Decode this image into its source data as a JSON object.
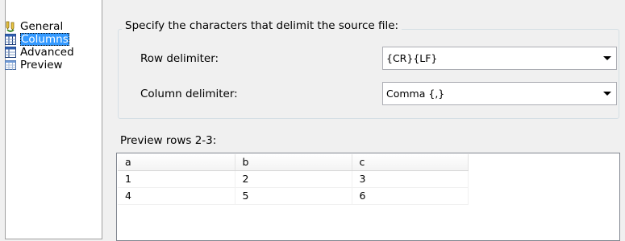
{
  "nav": {
    "items": [
      {
        "label": "General",
        "icon": "general-icon",
        "selected": false
      },
      {
        "label": "Columns",
        "icon": "columns-icon",
        "selected": true
      },
      {
        "label": "Advanced",
        "icon": "advanced-icon",
        "selected": false
      },
      {
        "label": "Preview",
        "icon": "preview-icon",
        "selected": false
      }
    ]
  },
  "delimiters": {
    "legend": "Specify the characters that delimit the source file:",
    "row": {
      "label": "Row delimiter:",
      "value": "{CR}{LF}"
    },
    "column": {
      "label": "Column delimiter:",
      "value": "Comma {,}"
    }
  },
  "preview": {
    "label": "Preview rows 2-3:",
    "columns": [
      "a",
      "b",
      "c"
    ],
    "rows": [
      [
        "1",
        "2",
        "3"
      ],
      [
        "4",
        "5",
        "6"
      ]
    ]
  },
  "colors": {
    "selection": "#3399ff",
    "panel_bg": "#f0f0f0",
    "border": "#a0a0a0"
  }
}
